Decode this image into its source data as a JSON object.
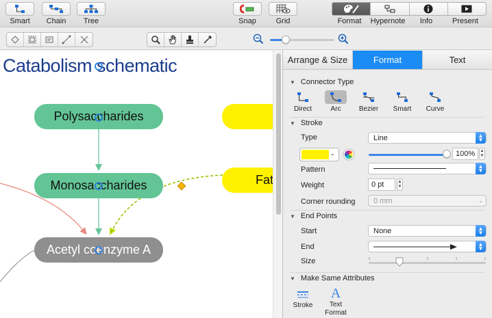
{
  "toolbar": {
    "smart_label": "Smart",
    "chain_label": "Chain",
    "tree_label": "Tree",
    "snap_label": "Snap",
    "grid_label": "Grid",
    "format_label": "Format",
    "hypernote_label": "Hypernote",
    "info_label": "Info",
    "present_label": "Present"
  },
  "diagram": {
    "title": "Catabolism schematic",
    "nodes": {
      "polysaccharides": "Polysaccharides",
      "monosaccharides": "Monosaccharides",
      "acetyl": "Acetyl coenzyme A",
      "fat": "Fat"
    },
    "colors": {
      "green_node": "#63c596",
      "gray_node": "#8f8f8f",
      "yellow_node": "#fff200",
      "title": "#1a3c8c",
      "connector_green": "#63c596",
      "connector_red": "#e8877c",
      "connector_selected": "#b6e000"
    }
  },
  "panel": {
    "tabs": [
      "Arrange & Size",
      "Format",
      "Text"
    ],
    "active_tab": "Format",
    "connector_type": {
      "heading": "Connector Type",
      "options": [
        "Direct",
        "Arc",
        "Bezier",
        "Smart",
        "Curve"
      ],
      "selected": "Arc"
    },
    "stroke": {
      "heading": "Stroke",
      "type_label": "Type",
      "type_value": "Line",
      "color": "#fff200",
      "opacity": "100%",
      "opacity_fraction": 1.0,
      "pattern_label": "Pattern",
      "weight_label": "Weight",
      "weight_value": "0 pt",
      "corner_label": "Corner rounding",
      "corner_value": "0 mm"
    },
    "end_points": {
      "heading": "End Points",
      "start_label": "Start",
      "start_value": "None",
      "end_label": "End",
      "size_label": "Size",
      "size_fraction": 0.25
    },
    "make_same": {
      "heading": "Make Same Attributes",
      "stroke_label": "Stroke",
      "text_format_label_1": "Text",
      "text_format_label_2": "Format"
    }
  }
}
